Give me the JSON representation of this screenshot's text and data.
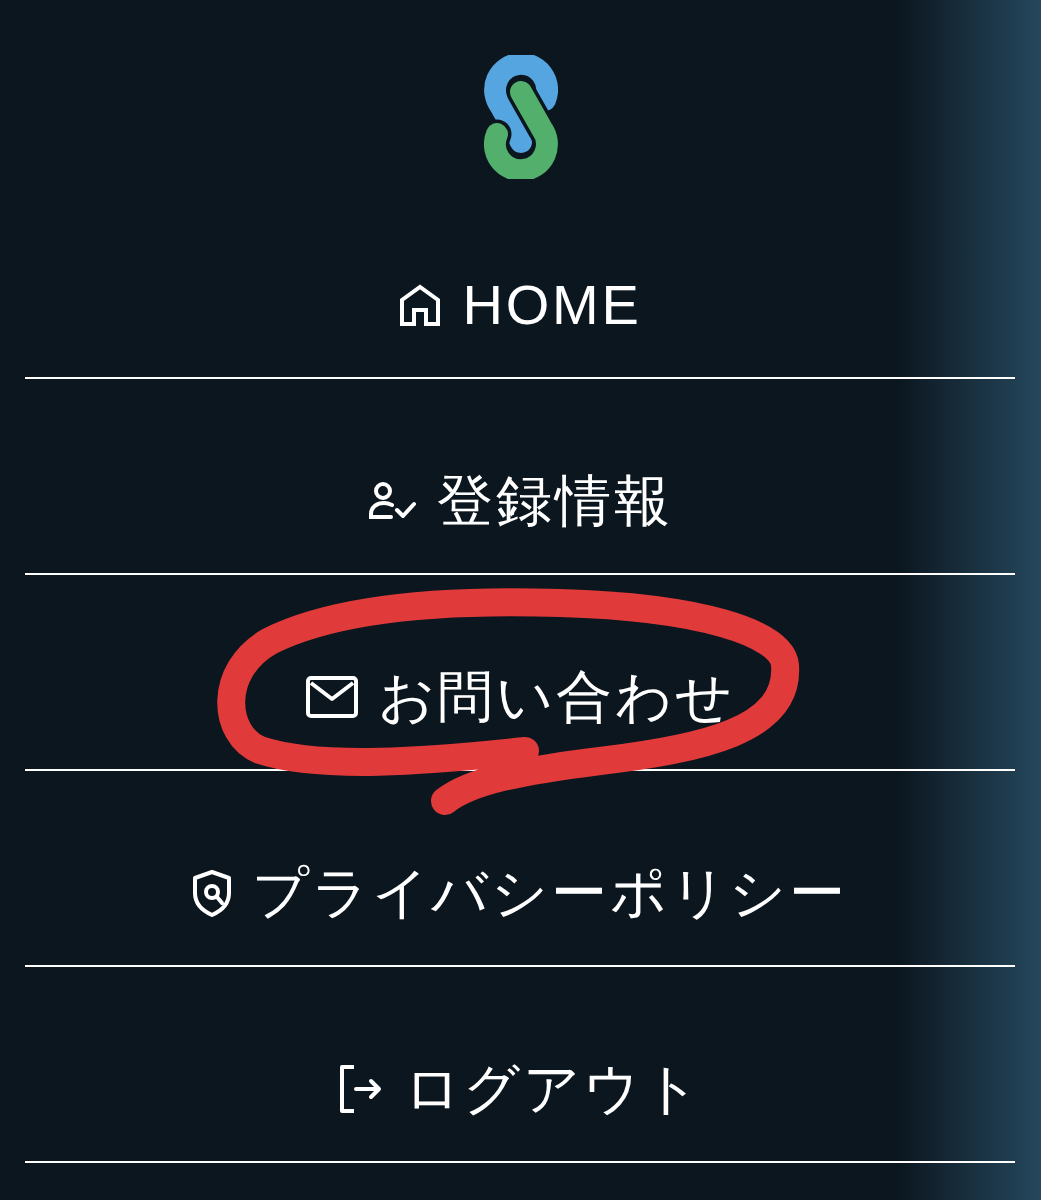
{
  "menu": {
    "items": [
      {
        "kind": "home",
        "label": "HOME",
        "circled": false
      },
      {
        "kind": "profile",
        "label": "登録情報",
        "circled": false
      },
      {
        "kind": "contact",
        "label": "お問い合わせ",
        "circled": true
      },
      {
        "kind": "privacy",
        "label": "プライバシーポリシー",
        "circled": false
      },
      {
        "kind": "logout",
        "label": "ログアウト",
        "circled": false
      }
    ]
  }
}
